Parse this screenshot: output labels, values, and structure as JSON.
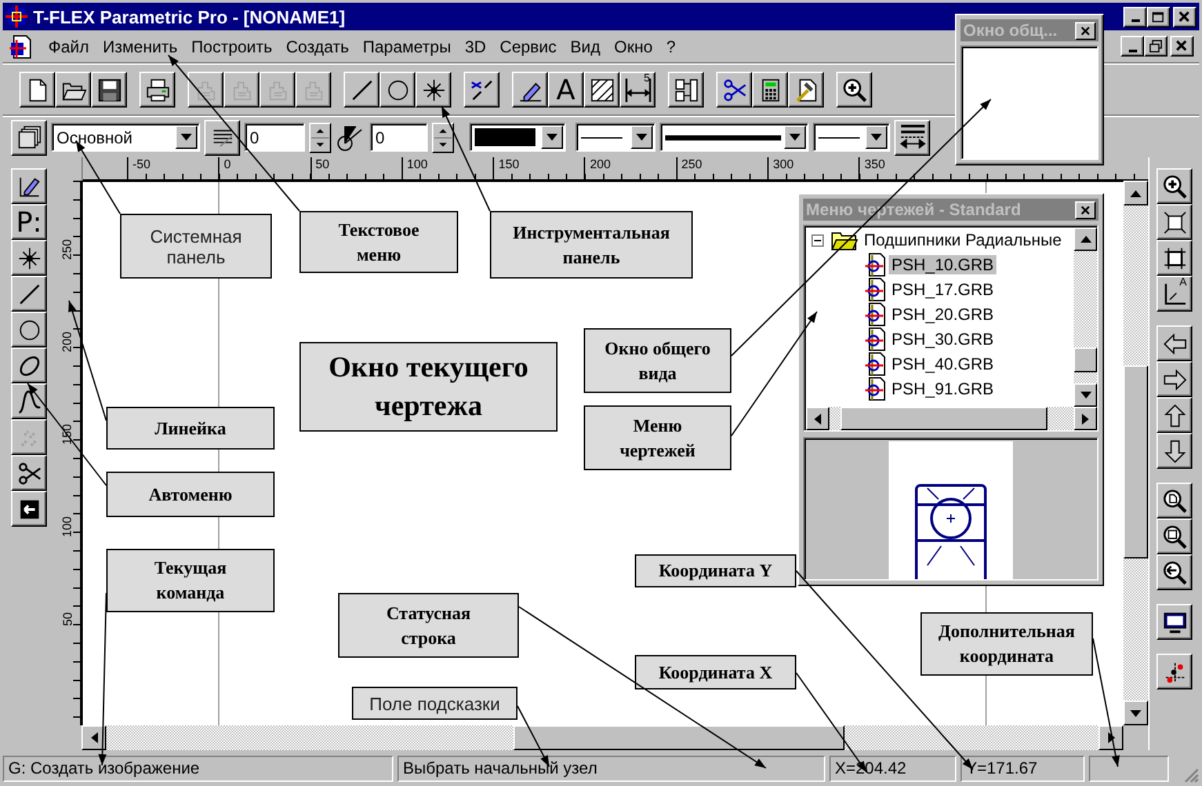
{
  "window": {
    "title": "T-FLEX Parametric Pro - [NONAME1]"
  },
  "menu": [
    "Файл",
    "Изменить",
    "Построить",
    "Создать",
    "Параметры",
    "3D",
    "Сервис",
    "Вид",
    "Окно",
    "?"
  ],
  "toolbar": [
    [
      {
        "kind": "new",
        "disabled": false
      },
      {
        "kind": "open",
        "disabled": false
      },
      {
        "kind": "save",
        "disabled": false
      }
    ],
    [
      {
        "kind": "print",
        "disabled": false
      }
    ],
    [
      {
        "kind": "edit",
        "disabled": true
      },
      {
        "kind": "edit",
        "disabled": true
      },
      {
        "kind": "edit",
        "disabled": true
      },
      {
        "kind": "edit",
        "disabled": true
      }
    ],
    [
      {
        "kind": "line",
        "disabled": false
      },
      {
        "kind": "circle",
        "disabled": false
      },
      {
        "kind": "node",
        "disabled": false
      }
    ],
    [
      {
        "kind": "linecut",
        "disabled": false
      }
    ],
    [
      {
        "kind": "pen",
        "disabled": false
      },
      {
        "kind": "text",
        "glyph": "A",
        "disabled": false
      },
      {
        "kind": "hatch",
        "disabled": false
      },
      {
        "kind": "dimension",
        "glyph": "5",
        "disabled": false
      }
    ],
    [
      {
        "kind": "pages",
        "disabled": false
      }
    ],
    [
      {
        "kind": "cut",
        "disabled": false
      },
      {
        "kind": "calc",
        "disabled": false
      },
      {
        "kind": "hammer",
        "disabled": false
      }
    ],
    [
      {
        "kind": "zoomin",
        "disabled": false
      }
    ]
  ],
  "properties_bar": {
    "layer": "Основной",
    "hatch_value": "0",
    "angle_value": "0"
  },
  "rulers": {
    "horizontal": [
      "-50",
      "0",
      "50",
      "100",
      "150",
      "200",
      "250",
      "300",
      "350"
    ],
    "vertical": [
      "250",
      "200",
      "150",
      "100",
      "50"
    ]
  },
  "left_toolbar": [
    {
      "kind": "draw",
      "disabled": false
    },
    {
      "kind": "text",
      "glyph": "P:",
      "disabled": false
    },
    {
      "kind": "node",
      "disabled": false
    },
    {
      "kind": "line",
      "disabled": false
    },
    {
      "kind": "circle",
      "disabled": false
    },
    {
      "kind": "ellipse",
      "disabled": false
    },
    {
      "kind": "spline",
      "disabled": false
    },
    {
      "kind": "dots",
      "disabled": true
    },
    {
      "kind": "trim",
      "disabled": false
    },
    {
      "kind": "exit",
      "disabled": false
    }
  ],
  "right_toolbar": [
    [
      {
        "kind": "zoomin",
        "disabled": false
      },
      {
        "kind": "fit",
        "disabled": false
      },
      {
        "kind": "fitinner",
        "disabled": false
      },
      {
        "kind": "axes",
        "glyph": "A",
        "disabled": false
      }
    ],
    [
      {
        "kind": "left",
        "disabled": false
      },
      {
        "kind": "right",
        "disabled": false
      },
      {
        "kind": "up",
        "disabled": false
      },
      {
        "kind": "down",
        "disabled": false
      }
    ],
    [
      {
        "kind": "zoompage",
        "disabled": false
      },
      {
        "kind": "zoomwin",
        "disabled": false
      },
      {
        "kind": "zoomback",
        "disabled": false
      }
    ],
    [
      {
        "kind": "monitor",
        "disabled": false
      }
    ],
    [
      {
        "kind": "points",
        "disabled": false
      }
    ]
  ],
  "callouts": [
    {
      "text": "Системная\nпанель",
      "kind": "plain"
    },
    {
      "text": "Текстовое\nменю",
      "kind": "bold"
    },
    {
      "text": "Инструментальная\nпанель",
      "kind": "bold"
    },
    {
      "text": "Окно текущего\nчертежа",
      "kind": "title"
    },
    {
      "text": "Окно общего\nвида",
      "kind": "bold"
    },
    {
      "text": "Линейка",
      "kind": "bold"
    },
    {
      "text": "Меню\nчертежей",
      "kind": "bold"
    },
    {
      "text": "Автоменю",
      "kind": "bold"
    },
    {
      "text": "Текущая\nкоманда",
      "kind": "bold"
    },
    {
      "text": "Координата Y",
      "kind": "bold"
    },
    {
      "text": "Статусная\nстрока",
      "kind": "bold"
    },
    {
      "text": "Дополнительная\nкоордината",
      "kind": "bold"
    },
    {
      "text": "Координата X",
      "kind": "bold"
    },
    {
      "text": "Поле подсказки",
      "kind": "plain"
    }
  ],
  "overview_window": {
    "title": "Окно общ..."
  },
  "drawings_menu": {
    "title": "Меню чертежей - Standard",
    "tree": [
      {
        "label": "Подшипники Радиальные",
        "expanded": true,
        "children": [
          {
            "label": "PSH_10.GRB",
            "selected": true
          },
          {
            "label": "PSH_17.GRB",
            "selected": false
          },
          {
            "label": "PSH_20.GRB",
            "selected": false
          },
          {
            "label": "PSH_30.GRB",
            "selected": false
          },
          {
            "label": "PSH_40.GRB",
            "selected": false
          },
          {
            "label": "PSH_91.GRB",
            "selected": false
          }
        ]
      }
    ]
  },
  "status_bar": {
    "command": "G: Создать изображение",
    "hint": "Выбрать начальный узел",
    "x": "X=204.42",
    "y": "Y=171.67"
  }
}
